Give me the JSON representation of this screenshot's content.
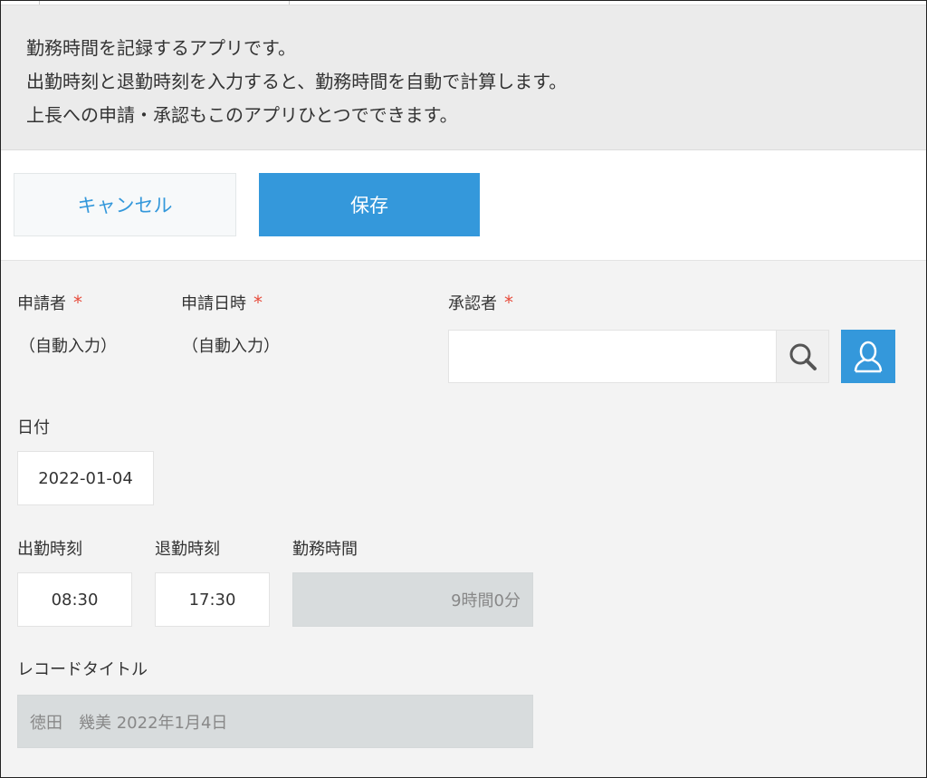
{
  "description": {
    "line1": "勤務時間を記録するアプリです。",
    "line2": "出勤時刻と退勤時刻を入力すると、勤務時間を自動で計算します。",
    "line3": "上長への申請・承認もこのアプリひとつでできます。"
  },
  "toolbar": {
    "cancel_label": "キャンセル",
    "save_label": "保存"
  },
  "form": {
    "applicant": {
      "label": "申請者",
      "required_mark": "*",
      "value": "（自動入力）"
    },
    "applied_at": {
      "label": "申請日時",
      "required_mark": "*",
      "value": "（自動入力）"
    },
    "approver": {
      "label": "承認者",
      "required_mark": "*",
      "value": ""
    },
    "date": {
      "label": "日付",
      "value": "2022-01-04"
    },
    "start_time": {
      "label": "出勤時刻",
      "value": "08:30"
    },
    "end_time": {
      "label": "退勤時刻",
      "value": "17:30"
    },
    "work_hours": {
      "label": "勤務時間",
      "value": "9時間0分"
    },
    "record_title": {
      "label": "レコードタイトル",
      "value": "徳田　幾美 2022年1月4日"
    }
  },
  "icons": {
    "search": "search-icon",
    "user": "user-icon"
  },
  "colors": {
    "accent": "#3498db",
    "required": "#e74c3c",
    "calc_bg": "#d8dcdd"
  }
}
